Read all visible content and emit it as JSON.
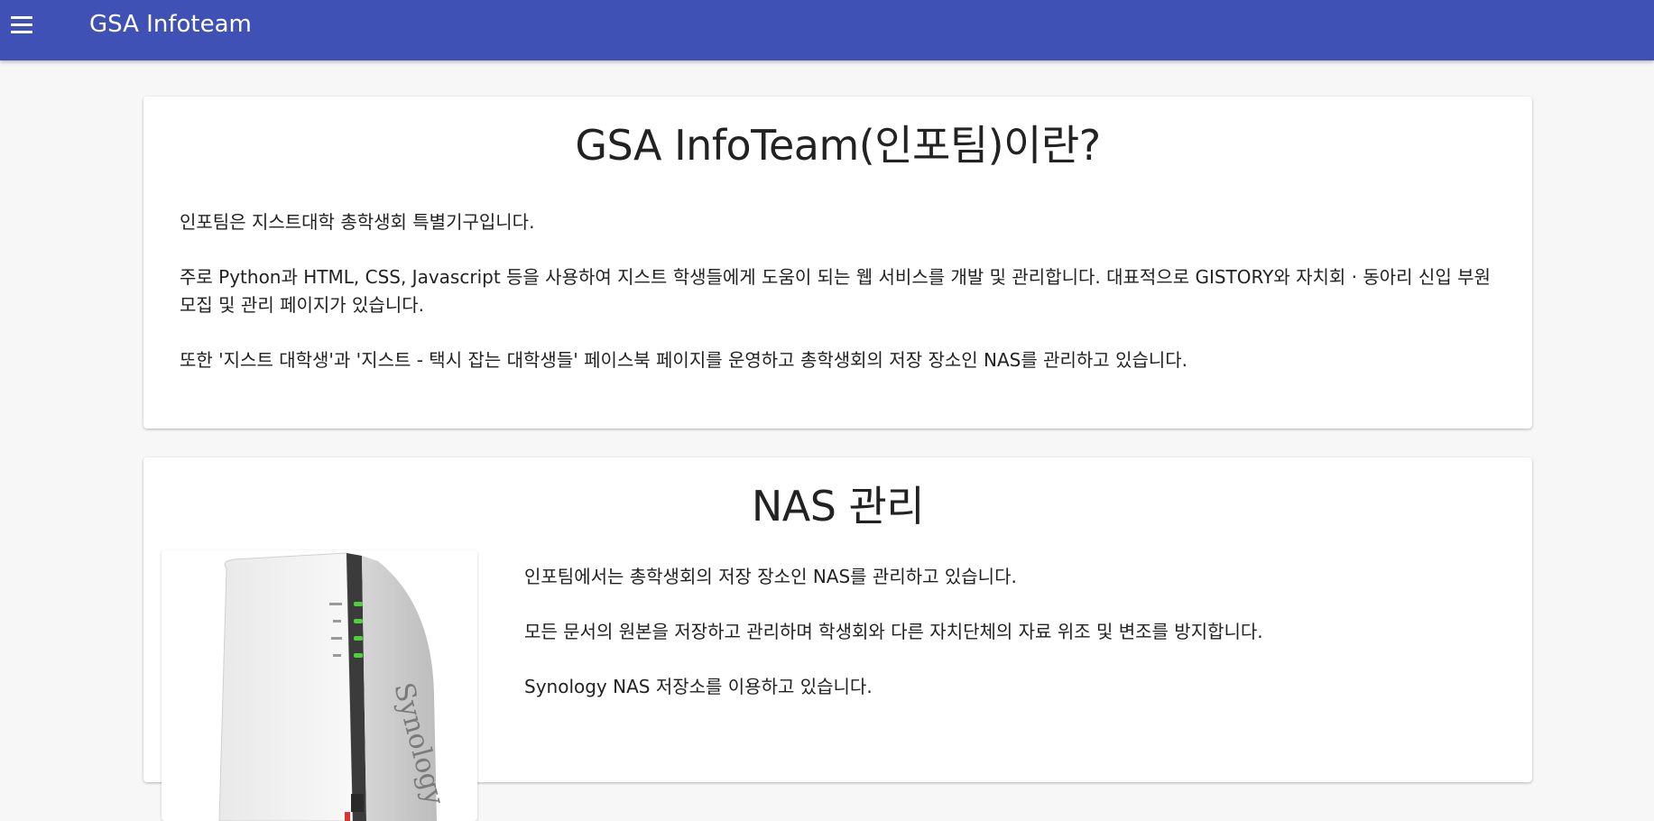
{
  "appbar": {
    "title": "GSA Infoteam",
    "background_color": "#3f51b5",
    "menu_icon": "menu-icon"
  },
  "intro": {
    "title": "GSA InfoTeam(인포팀)이란?",
    "paragraphs": [
      "인포팀은 지스트대학 총학생회 특별기구입니다.",
      "주로 Python과 HTML, CSS, Javascript 등을 사용하여 지스트 학생들에게 도움이 되는 웹 서비스를 개발 및 관리합니다. 대표적으로 GISTORY와 자치회 · 동아리 신입 부원 모집 및 관리 페이지가 있습니다.",
      "또한 '지스트 대학생'과 '지스트 - 택시 잡는 대학생들' 페이스북 페이지를 운영하고 총학생회의 저장 장소인 NAS를 관리하고 있습니다."
    ]
  },
  "nas": {
    "title": "NAS 관리",
    "image_brand": "Synology",
    "paragraphs": [
      "인포팀에서는 총학생회의 저장 장소인 NAS를 관리하고 있습니다.",
      "모든 문서의 원본을 저장하고 관리하며 학생회와 다른 자치단체의 자료 위조 및 변조를 방지합니다.",
      "Synology NAS 저장소를 이용하고 있습니다."
    ]
  }
}
